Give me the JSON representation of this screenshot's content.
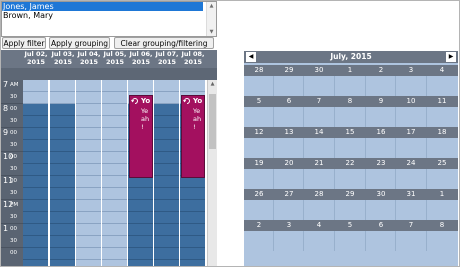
{
  "resources": {
    "items": [
      {
        "label": "Jones, James",
        "selected": true
      },
      {
        "label": "Brown, Mary",
        "selected": false
      }
    ]
  },
  "toolbar": {
    "apply_filter": "Apply filter",
    "apply_grouping": "Apply grouping",
    "clear": "Clear grouping/filtering"
  },
  "scheduler": {
    "days": [
      {
        "l1": "Jul 02,",
        "l2": "2015"
      },
      {
        "l1": "Jul 03,",
        "l2": "2015"
      },
      {
        "l1": "Jul 04,",
        "l2": "2015"
      },
      {
        "l1": "Jul 05,",
        "l2": "2015"
      },
      {
        "l1": "Jul 06,",
        "l2": "2015"
      },
      {
        "l1": "Jul 07,",
        "l2": "2015"
      },
      {
        "l1": "Jul 08,",
        "l2": "2015"
      }
    ],
    "time_labels": [
      {
        "kind": "h",
        "text": "7"
      },
      {
        "kind": "m",
        "text": "AM"
      },
      {
        "kind": "m",
        "text": "30"
      },
      {
        "kind": "h",
        "text": "8"
      },
      {
        "kind": "m",
        "text": "00"
      },
      {
        "kind": "m",
        "text": "30"
      },
      {
        "kind": "h",
        "text": "9"
      },
      {
        "kind": "m",
        "text": "00"
      },
      {
        "kind": "m",
        "text": "30"
      },
      {
        "kind": "h",
        "text": "10"
      },
      {
        "kind": "m",
        "text": "00"
      },
      {
        "kind": "m",
        "text": "30"
      },
      {
        "kind": "h",
        "text": "11"
      },
      {
        "kind": "m",
        "text": "00"
      },
      {
        "kind": "m",
        "text": "30"
      },
      {
        "kind": "h",
        "text": "12"
      },
      {
        "kind": "m",
        "text": "PM"
      },
      {
        "kind": "m",
        "text": "30"
      },
      {
        "kind": "h",
        "text": "1"
      },
      {
        "kind": "m",
        "text": "00"
      },
      {
        "kind": "m",
        "text": "30"
      },
      {
        "kind": "m",
        "text": "00"
      }
    ],
    "appointments": [
      {
        "title": "Yo",
        "body": "Ye ah !",
        "day": 4
      },
      {
        "title": "Yo",
        "body": "Ye ah !",
        "day": 6
      }
    ],
    "colors": {
      "working": "#3d6e9f",
      "free": "#aec4df",
      "appointment": "#a3105f",
      "header": "#6c7685"
    }
  },
  "calendar": {
    "title": "July, 2015",
    "prev_icon": "chevron-left-icon",
    "next_icon": "chevron-right-icon",
    "weeks": [
      [
        "28",
        "29",
        "30",
        "1",
        "2",
        "3",
        "4"
      ],
      [
        "5",
        "6",
        "7",
        "8",
        "9",
        "10",
        "11"
      ],
      [
        "12",
        "13",
        "14",
        "15",
        "16",
        "17",
        "18"
      ],
      [
        "19",
        "20",
        "21",
        "22",
        "23",
        "24",
        "25"
      ],
      [
        "26",
        "27",
        "28",
        "29",
        "30",
        "31",
        "1"
      ],
      [
        "2",
        "3",
        "4",
        "5",
        "6",
        "7",
        "8"
      ]
    ]
  }
}
